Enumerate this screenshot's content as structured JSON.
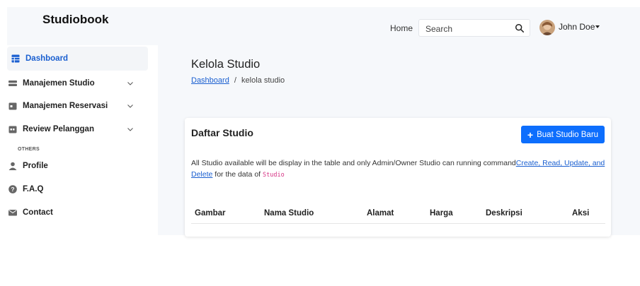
{
  "header": {
    "brand": "Studiobook",
    "nav_home": "Home",
    "search_placeholder": "Search",
    "user_name": "John Doe"
  },
  "sidebar": {
    "items": [
      {
        "label": "Dashboard",
        "icon": "table-icon",
        "active": true
      },
      {
        "label": "Manajemen Studio",
        "icon": "drawer-icon",
        "expandable": true
      },
      {
        "label": "Manajemen Reservasi",
        "icon": "calendar-icon",
        "expandable": true
      },
      {
        "label": "Review Pelanggan",
        "icon": "calendar-check-icon",
        "expandable": true
      }
    ],
    "section_label": "OTHERS",
    "others": [
      {
        "label": "Profile",
        "icon": "person-icon"
      },
      {
        "label": "F.A.Q",
        "icon": "question-icon"
      },
      {
        "label": "Contact",
        "icon": "envelope-icon"
      }
    ]
  },
  "main": {
    "title": "Kelola Studio",
    "breadcrumb_link": "Dashboard",
    "breadcrumb_separator": "/",
    "breadcrumb_current": "kelola studio",
    "card": {
      "title": "Daftar Studio",
      "new_button": "Buat Studio Baru",
      "desc_before": "All Studio available will be display in the table and only Admin/Owner Studio can running command",
      "desc_command": "Create, Read, Update, and Delete",
      "desc_middle": " for the data of ",
      "desc_code": "Studio",
      "columns": [
        "Gambar",
        "Nama Studio",
        "Alamat",
        "Harga",
        "Deskripsi",
        "Aksi"
      ]
    }
  },
  "colors": {
    "accent": "#0d6efd",
    "link": "#1a5fd0",
    "sidebar_active_bg": "#f3f5f8",
    "page_bg": "#f6f8fb",
    "code": "#d63384"
  }
}
